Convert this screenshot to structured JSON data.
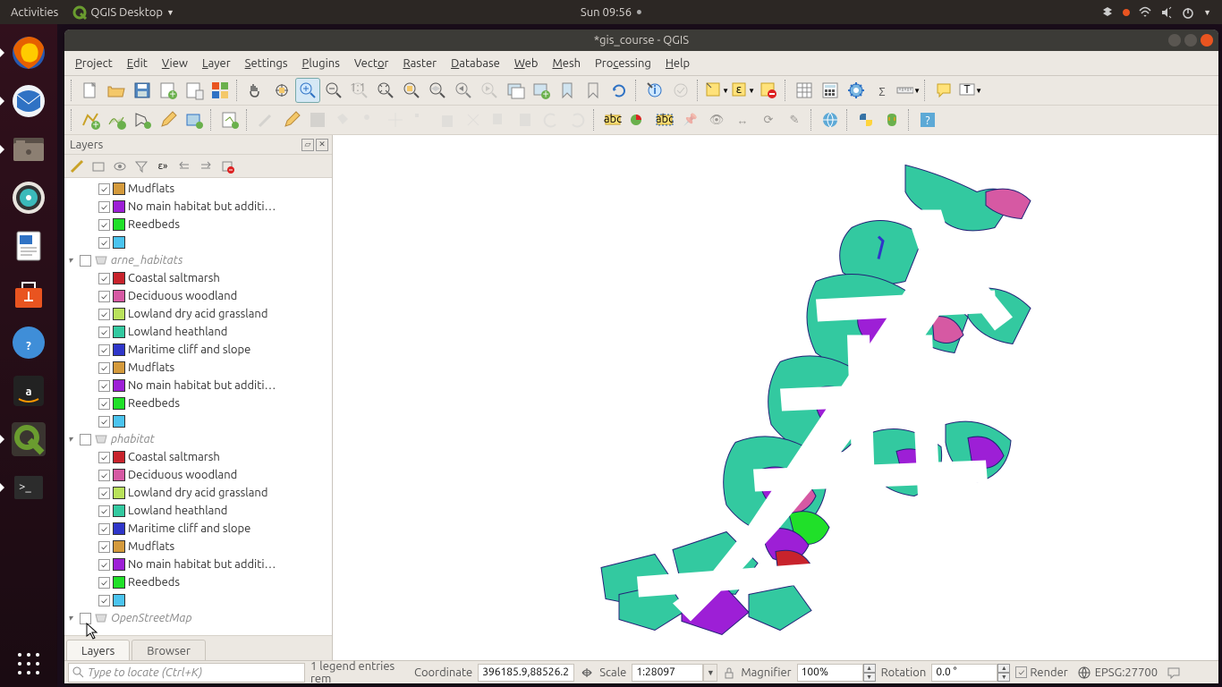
{
  "topbar": {
    "activities": "Activities",
    "app": "QGIS Desktop",
    "clock": "Sun 09:56"
  },
  "window": {
    "title": "*gis_course - QGIS"
  },
  "menu": [
    "Project",
    "Edit",
    "View",
    "Layer",
    "Settings",
    "Plugins",
    "Vector",
    "Raster",
    "Database",
    "Web",
    "Mesh",
    "Processing",
    "Help"
  ],
  "panel": {
    "title": "Layers"
  },
  "layers": {
    "top_symbols": [
      {
        "color": "#d49a3c",
        "label": "Mudflats"
      },
      {
        "color": "#9d1fd6",
        "label": "No main habitat but additi…"
      },
      {
        "color": "#20e029",
        "label": "Reedbeds"
      },
      {
        "color": "#4bc4ef",
        "label": ""
      }
    ],
    "groups": [
      {
        "name": "arne_habitats",
        "checked": false,
        "items": [
          {
            "color": "#c8232c",
            "label": "Coastal saltmarsh"
          },
          {
            "color": "#d659a3",
            "label": "Deciduous woodland"
          },
          {
            "color": "#b9e25b",
            "label": "Lowland dry acid grassland"
          },
          {
            "color": "#33c9a0",
            "label": "Lowland heathland"
          },
          {
            "color": "#2f36c9",
            "label": "Maritime cliff and slope"
          },
          {
            "color": "#d49a3c",
            "label": "Mudflats"
          },
          {
            "color": "#9d1fd6",
            "label": "No main habitat but additi…"
          },
          {
            "color": "#20e029",
            "label": "Reedbeds"
          },
          {
            "color": "#4bc4ef",
            "label": ""
          }
        ]
      },
      {
        "name": "phabitat",
        "checked": false,
        "items": [
          {
            "color": "#c8232c",
            "label": "Coastal saltmarsh"
          },
          {
            "color": "#d659a3",
            "label": "Deciduous woodland"
          },
          {
            "color": "#b9e25b",
            "label": "Lowland dry acid grassland"
          },
          {
            "color": "#33c9a0",
            "label": "Lowland heathland"
          },
          {
            "color": "#2f36c9",
            "label": "Maritime cliff and slope"
          },
          {
            "color": "#d49a3c",
            "label": "Mudflats"
          },
          {
            "color": "#9d1fd6",
            "label": "No main habitat but additi…"
          },
          {
            "color": "#20e029",
            "label": "Reedbeds"
          },
          {
            "color": "#4bc4ef",
            "label": ""
          }
        ]
      },
      {
        "name": "OpenStreetMap",
        "checked": false,
        "items": []
      }
    ]
  },
  "tabs": {
    "layers": "Layers",
    "browser": "Browser"
  },
  "status": {
    "locate_placeholder": "Type to locate (Ctrl+K)",
    "legend": "1 legend entries rem",
    "coord_label": "Coordinate",
    "coord": "396185.9,88526.2",
    "scale_label": "Scale",
    "scale": "1:28097",
    "mag_label": "Magnifier",
    "mag": "100%",
    "rot_label": "Rotation",
    "rot": "0.0 °",
    "render": "Render",
    "crs": "EPSG:27700"
  }
}
